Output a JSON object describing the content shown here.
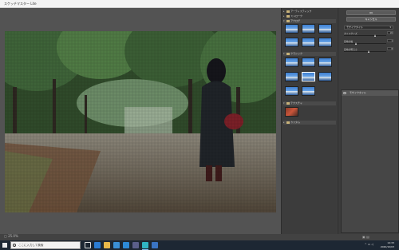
{
  "window": {
    "title": "スケッチマスター Lite"
  },
  "canvas": {
    "zoom_label": "25.0%"
  },
  "library": {
    "folders": [
      {
        "name": "アーティスティック",
        "expanded": false
      },
      {
        "name": "ストローク",
        "expanded": false
      },
      {
        "name": "アナログ",
        "expanded": true
      },
      {
        "name": "クラシック",
        "expanded": true
      },
      {
        "name": "テクスチャ",
        "expanded": true
      },
      {
        "name": "カスタム",
        "expanded": false
      }
    ],
    "analog_thumbs": [
      "",
      "",
      "",
      "",
      "",
      ""
    ],
    "classic_thumbs": [
      "",
      "",
      "",
      "",
      "",
      "",
      "",
      ""
    ],
    "custom_thumbs": [
      ""
    ]
  },
  "panel": {
    "ok_button": "OK",
    "cancel_button": "キャンセル",
    "preset_dropdown": "モザイクタイル",
    "sliders": [
      {
        "label": "タイルサイズ",
        "value": "20"
      },
      {
        "label": "目地の幅",
        "value": "1"
      },
      {
        "label": "目地の明るさ",
        "value": "8"
      }
    ],
    "layer_name": "モザイクタイル"
  },
  "taskbar": {
    "search_placeholder": "ここに入力して検索",
    "time": "14:33",
    "date": "2020/10/03"
  }
}
